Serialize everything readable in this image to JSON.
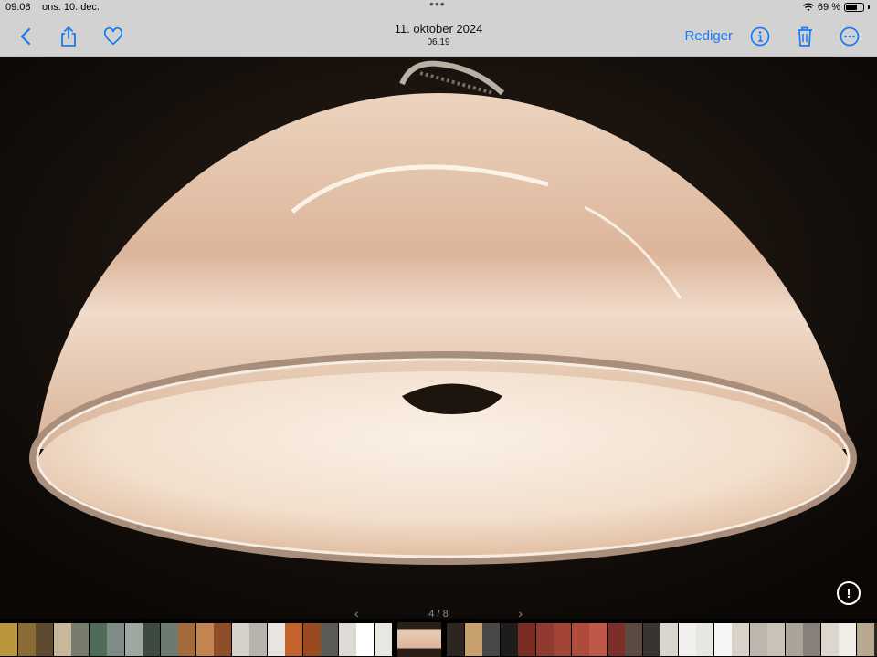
{
  "status": {
    "time": "09.08",
    "date": "ons. 10. dec.",
    "battery": "69 %",
    "battery_level": 0.69
  },
  "nav": {
    "title": "11. oktober 2024",
    "subtitle": "06.19",
    "edit_label": "Rediger",
    "back_icon": "chevron-left-icon",
    "share_icon": "share-icon",
    "favorite_icon": "heart-icon",
    "info_icon": "info-icon",
    "delete_icon": "trash-icon",
    "more_icon": "more-icon"
  },
  "viewer": {
    "pager": "4 / 8",
    "alert_icon": "exclamation-icon"
  },
  "colors": {
    "accent": "#1a7bf2",
    "bar": "#d2d2d2"
  }
}
